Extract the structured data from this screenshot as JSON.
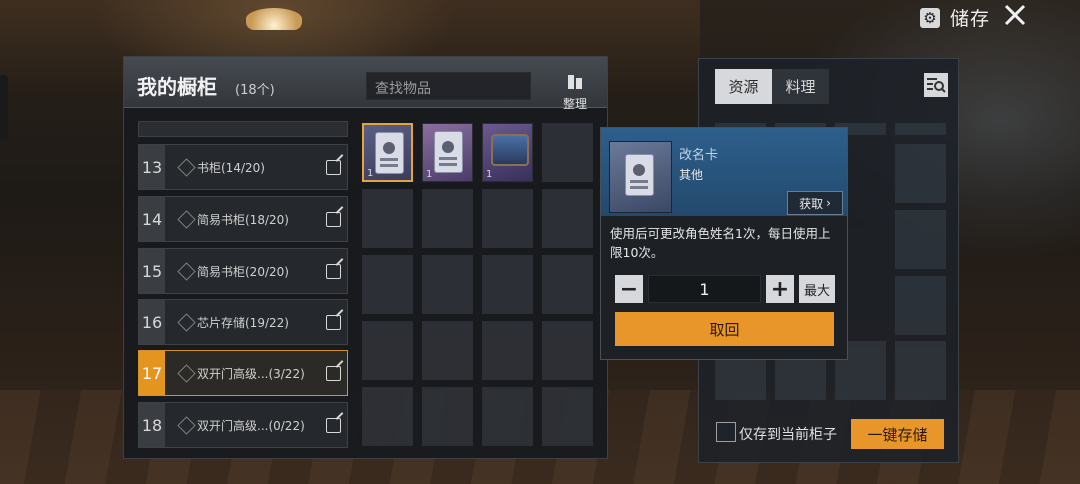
{
  "header": {
    "storage_title": "储存"
  },
  "cabinet": {
    "title": "我的橱柜",
    "count": "(18个)",
    "search_placeholder": "查找物品",
    "sort_label": "整理",
    "items": [
      {
        "num": "13",
        "label": "书柜(14/20)",
        "active": false
      },
      {
        "num": "14",
        "label": "简易书柜(18/20)",
        "active": false
      },
      {
        "num": "15",
        "label": "简易书柜(20/20)",
        "active": false
      },
      {
        "num": "16",
        "label": "芯片存储(19/22)",
        "active": false
      },
      {
        "num": "17",
        "label": "双开门高级...(3/22)",
        "active": true
      },
      {
        "num": "18",
        "label": "双开门高级...(0/22)",
        "active": false
      }
    ],
    "slots": [
      {
        "qty": "1",
        "art": "card"
      },
      {
        "qty": "1",
        "art": "card"
      },
      {
        "qty": "1",
        "art": "chest"
      }
    ]
  },
  "resource_panel": {
    "tabs": [
      "资源",
      "料理"
    ],
    "only_current_label": "仅存到当前柜子",
    "store_all_label": "一键存储"
  },
  "tooltip": {
    "name": "改名卡",
    "category": "其他",
    "get_label": "获取",
    "description": "使用后可更改角色姓名1次，每日使用上限10次。",
    "quantity": "1",
    "max_label": "最大",
    "retrieve_label": "取回"
  },
  "colors": {
    "accent": "#e8962a",
    "active_tab": "#e3951f",
    "tooltip_header": "#2d5f8c"
  }
}
